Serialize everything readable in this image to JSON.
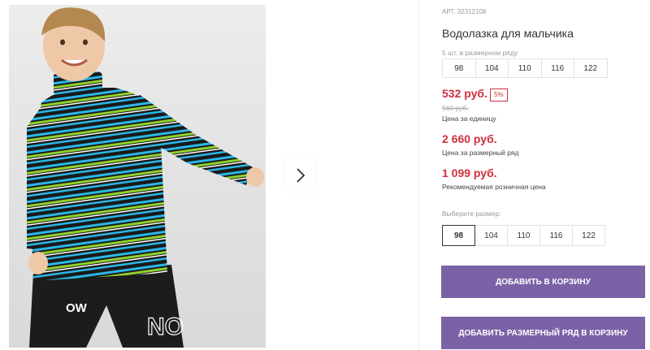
{
  "product": {
    "article": "АРТ. 32312108",
    "title": "Водолазка для мальчика",
    "row_caption": "5 шт. в размерном ряду",
    "row_sizes": [
      "98",
      "104",
      "110",
      "116",
      "122"
    ],
    "price": "532 руб.",
    "discount": "5%",
    "old_price": "560 руб.",
    "price_note": "Цена за единицу",
    "row_price": "2 660 руб.",
    "row_price_note": "Цена за размерный ряд",
    "retail_price": "1 099 руб.",
    "retail_price_note": "Рекомендуемая розничная цена",
    "choose_label": "Выберите размер:",
    "choose_sizes": [
      "98",
      "104",
      "110",
      "116",
      "122"
    ],
    "selected_size": "98",
    "add_to_cart": "ДОБАВИТЬ В КОРЗИНУ",
    "add_row_to_cart": "ДОБАВИТЬ РАЗМЕРНЫЙ РЯД В КОРЗИНУ"
  },
  "photo": {
    "print_text_1": "OW",
    "print_text_2": "NO",
    "stripe_colors": [
      "#1a1a1a",
      "#2ab7e6",
      "#8fd12c",
      "#ffffff"
    ]
  },
  "colors": {
    "accent": "#7b62a6",
    "price": "#d02f3c"
  }
}
